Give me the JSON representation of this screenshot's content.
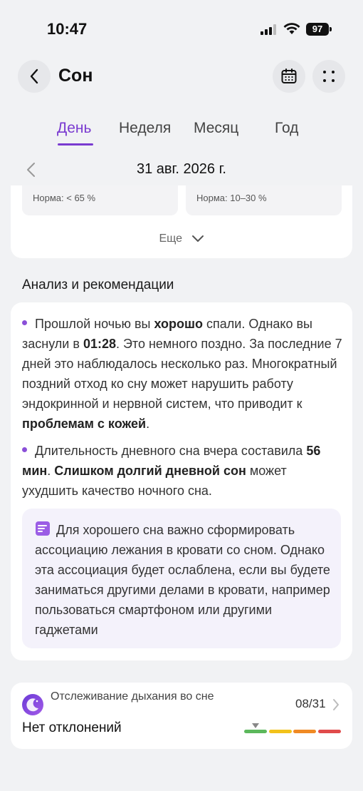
{
  "status_bar": {
    "time": "10:47",
    "battery": "97"
  },
  "header": {
    "title": "Сон"
  },
  "tabs": [
    {
      "label": "День",
      "active": true
    },
    {
      "label": "Неделя",
      "active": false
    },
    {
      "label": "Месяц",
      "active": false
    },
    {
      "label": "Год",
      "active": false
    }
  ],
  "date": {
    "label": "31 авг. 2026 г."
  },
  "norms": {
    "left": "Норма: < 65 %",
    "right": "Норма: 10–30 %"
  },
  "more_label": "Еще",
  "analysis": {
    "title": "Анализ и рекомендации",
    "p1": {
      "t1": "Прошлой ночью вы ",
      "b1": "хорошо",
      "t2": " спали. Однако вы заснули в ",
      "b2": "01:28",
      "t3": ". Это немного поздно. За последние 7 дней это наблюдалось несколько раз. Многократный поздний отход ко сну может нарушить работу эндокринной и нервной систем, что приводит к ",
      "b3": "проблемам с кожей",
      "t4": "."
    },
    "p2": {
      "t1": "Длительность дневного сна вчера составила ",
      "b1": "56 мин",
      "t2": ". ",
      "b2": "Слишком долгий дневной сон",
      "t3": " может ухудшить качество ночного сна."
    },
    "tip": "Для хорошего сна важно сформировать ассоциацию лежания в кровати со сном. Однако эта ассоциация будет ослаблена, если вы будете заниматься другими делами в кровати, например пользоваться смартфоном или другими гаджетами"
  },
  "breathing": {
    "title": "Отслеживание дыхания во сне",
    "date": "08/31",
    "status": "Нет отклонений",
    "scale_colors": [
      "#5cb85c",
      "#f2c21b",
      "#f08a24",
      "#e04b4b"
    ]
  },
  "colors": {
    "accent": "#7a3bd0",
    "bullet": "#8a4fd8"
  }
}
